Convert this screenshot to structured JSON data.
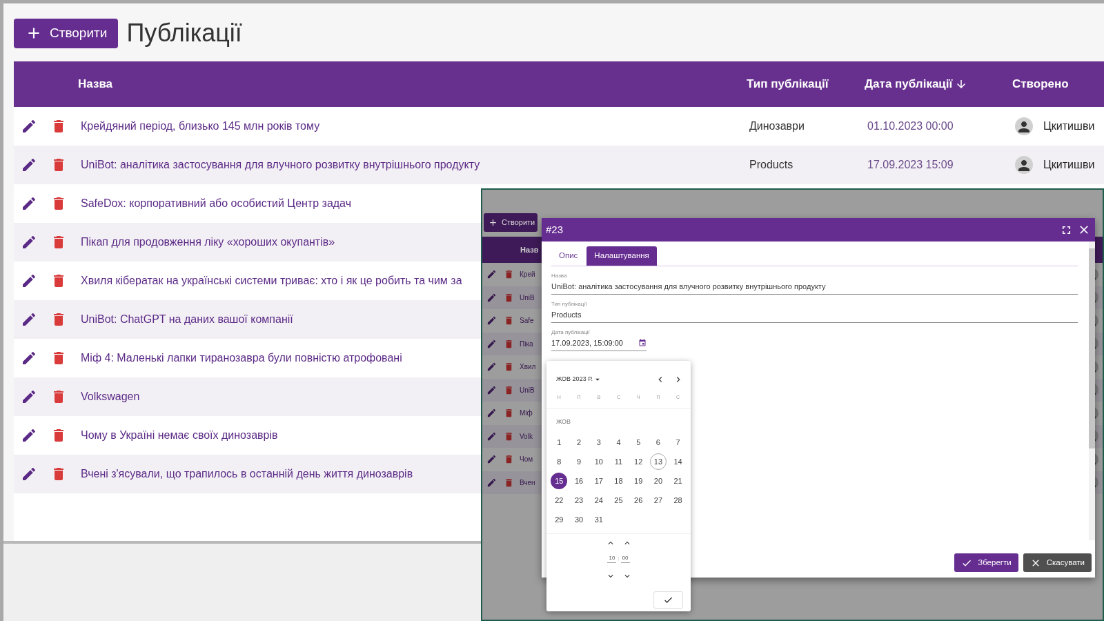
{
  "toolbar": {
    "create_button": "Створити",
    "title": "Публікації"
  },
  "table": {
    "columns": [
      {
        "label": "Назва",
        "sorted": false
      },
      {
        "label": "Тип публікації",
        "sorted": false
      },
      {
        "label": "Дата публікації",
        "sorted": true
      },
      {
        "label": "Створено",
        "sorted": false
      }
    ],
    "rows": [
      {
        "name": "Крейдяний період, близько 145 млн років тому",
        "type": "Динозаври",
        "date": "01.10.2023 00:00",
        "author": "Цкитишви"
      },
      {
        "name": "UniBot: аналітика застосування для влучного розвитку внутрішнього продукту",
        "type": "Products",
        "date": "17.09.2023 15:09",
        "author": "Цкитишви"
      },
      {
        "name": "SafeDox: корпоративний або особистий Центр задач"
      },
      {
        "name": "Пікап для продовження ліку «хороших окупантів»"
      },
      {
        "name": "Хвиля кібератак на українські системи триває: хто і як це робить та чим за"
      },
      {
        "name": "UniBot: ChatGPT на даних вашої компанії"
      },
      {
        "name": "Міф 4: Маленькі лапки тиранозавра були повністю атрофовані"
      },
      {
        "name": "Volkswagen"
      },
      {
        "name": "Чому в Україні немає своїх динозаврів"
      },
      {
        "name": "Вчені з'ясували, що трапилось в останній день життя динозаврів"
      }
    ]
  },
  "inset": {
    "create_button": "Створити",
    "column": "Назв",
    "rows": [
      "Крей",
      "UniB",
      "Safe",
      "Піка",
      "Хвил",
      "UniB",
      "Міф",
      "Volk",
      "Чом",
      "Вчен"
    ]
  },
  "dialog": {
    "title": "#23",
    "tabs": [
      {
        "label": "Опис",
        "selected": false
      },
      {
        "label": "Налаштування",
        "selected": true
      }
    ],
    "fields": [
      {
        "kind": "text",
        "label": "Назва",
        "value": "UniBot: аналітика застосування для влучного розвитку внутрішнього продукту"
      },
      {
        "kind": "text",
        "label": "Тип публікації",
        "value": "Products"
      },
      {
        "kind": "date",
        "label": "Дата публікації",
        "value": "17.09.2023, 15:09:00"
      }
    ],
    "buttons": [
      {
        "kind": "primary",
        "label": "Зберегти"
      },
      {
        "kind": "secondary",
        "label": "Скасувати"
      }
    ]
  },
  "datepicker": {
    "month_label": "ЖОВ 2023 Р.",
    "weekdays": [
      "Н",
      "П",
      "В",
      "С",
      "Ч",
      "П",
      "С"
    ],
    "month_short": "ЖОВ",
    "days": [
      {
        "label": "1",
        "selected": false,
        "today": false
      },
      {
        "label": "2",
        "selected": false,
        "today": false
      },
      {
        "label": "3",
        "selected": false,
        "today": false
      },
      {
        "label": "4",
        "selected": false,
        "today": false
      },
      {
        "label": "5",
        "selected": false,
        "today": false
      },
      {
        "label": "6",
        "selected": false,
        "today": false
      },
      {
        "label": "7",
        "selected": false,
        "today": false
      },
      {
        "label": "8",
        "selected": false,
        "today": false
      },
      {
        "label": "9",
        "selected": false,
        "today": false
      },
      {
        "label": "10",
        "selected": false,
        "today": false
      },
      {
        "label": "11",
        "selected": false,
        "today": false
      },
      {
        "label": "12",
        "selected": false,
        "today": false
      },
      {
        "label": "13",
        "selected": false,
        "today": true
      },
      {
        "label": "14",
        "selected": false,
        "today": false
      },
      {
        "label": "15",
        "selected": true,
        "today": false
      },
      {
        "label": "16",
        "selected": false,
        "today": false
      },
      {
        "label": "17",
        "selected": false,
        "today": false
      },
      {
        "label": "18",
        "selected": false,
        "today": false
      },
      {
        "label": "19",
        "selected": false,
        "today": false
      },
      {
        "label": "20",
        "selected": false,
        "today": false
      },
      {
        "label": "21",
        "selected": false,
        "today": false
      },
      {
        "label": "22",
        "selected": false,
        "today": false
      },
      {
        "label": "23",
        "selected": false,
        "today": false
      },
      {
        "label": "24",
        "selected": false,
        "today": false
      },
      {
        "label": "25",
        "selected": false,
        "today": false
      },
      {
        "label": "26",
        "selected": false,
        "today": false
      },
      {
        "label": "27",
        "selected": false,
        "today": false
      },
      {
        "label": "28",
        "selected": false,
        "today": false
      },
      {
        "label": "29",
        "selected": false,
        "today": false
      },
      {
        "label": "30",
        "selected": false,
        "today": false
      },
      {
        "label": "31",
        "selected": false,
        "today": false
      }
    ],
    "hour": "10",
    "separator": ":",
    "minute": "00"
  }
}
